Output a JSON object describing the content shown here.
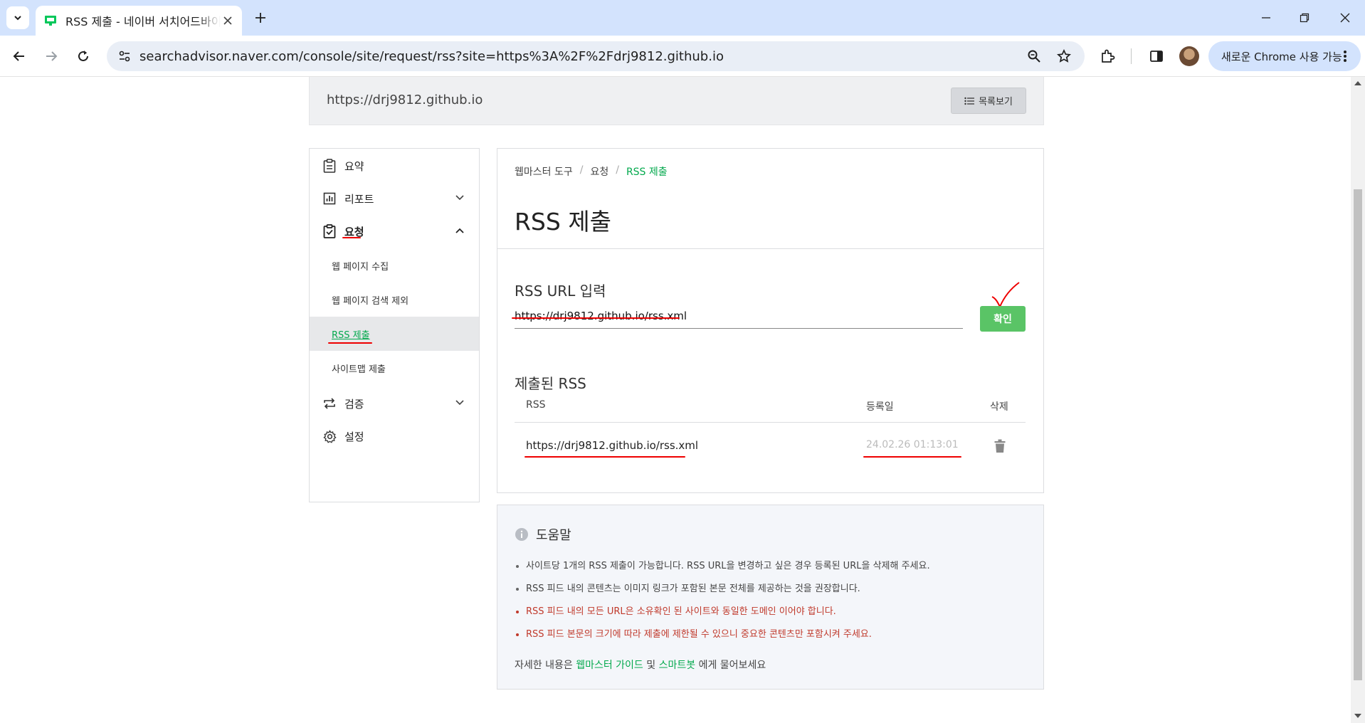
{
  "browser": {
    "tab_title": "RSS 제출 - 네이버 서치어드바이저",
    "url": "searchadvisor.naver.com/console/site/request/rss?site=https%3A%2F%2Fdrj9812.github.io",
    "update_label": "새로운 Chrome 사용 가능"
  },
  "site_bar": {
    "url": "https://drj9812.github.io",
    "list_button": "목록보기"
  },
  "sidebar": {
    "items": [
      {
        "label": "요약",
        "icon": "clipboard-icon"
      },
      {
        "label": "리포트",
        "icon": "chart-icon"
      },
      {
        "label": "요청",
        "icon": "clipboard-check-icon"
      },
      {
        "label": "검증",
        "icon": "repeat-icon"
      },
      {
        "label": "설정",
        "icon": "gear-icon"
      }
    ],
    "sub_items": [
      {
        "label": "웹 페이지 수집"
      },
      {
        "label": "웹 페이지 검색 제외"
      },
      {
        "label": "RSS 제출"
      },
      {
        "label": "사이트맵 제출"
      }
    ]
  },
  "main": {
    "breadcrumb": [
      "웹마스터 도구",
      "요청",
      "RSS 제출"
    ],
    "title": "RSS 제출",
    "input_section": "RSS URL 입력",
    "input_value": "https://drj9812.github.io/rss.xml",
    "confirm_label": "확인",
    "submitted_section": "제출된 RSS",
    "table": {
      "headers": [
        "RSS",
        "등록일",
        "삭제"
      ],
      "rows": [
        {
          "rss": "https://drj9812.github.io/rss.xml",
          "date": "24.02.26 01:13:01"
        }
      ]
    }
  },
  "help": {
    "title": "도움말",
    "items": [
      "사이트당 1개의 RSS 제출이 가능합니다. RSS URL을 변경하고 싶은 경우 등록된 URL을 삭제해 주세요.",
      "RSS 피드 내의 콘텐츠는 이미지 링크가 포함된 본문 전체를 제공하는 것을 권장합니다.",
      "RSS 피드 내의 모든 URL은 소유확인 된 사이트와 동일한 도메인 이어야 합니다.",
      "RSS 피드 본문의 크기에 따라 제출에 제한될 수 있으니 중요한 콘텐츠만 포함시켜 주세요."
    ],
    "footer_prefix": "자세한 내용은",
    "guide_link": "웹마스터 가이드",
    "and": "및",
    "bot_link": "스마트봇",
    "footer_suffix": "에게 물어보세요"
  },
  "colors": {
    "accent_green": "#03a94d",
    "button_green": "#5ac466",
    "warning_red": "#c0392b",
    "annotation_red": "#ee0000"
  }
}
